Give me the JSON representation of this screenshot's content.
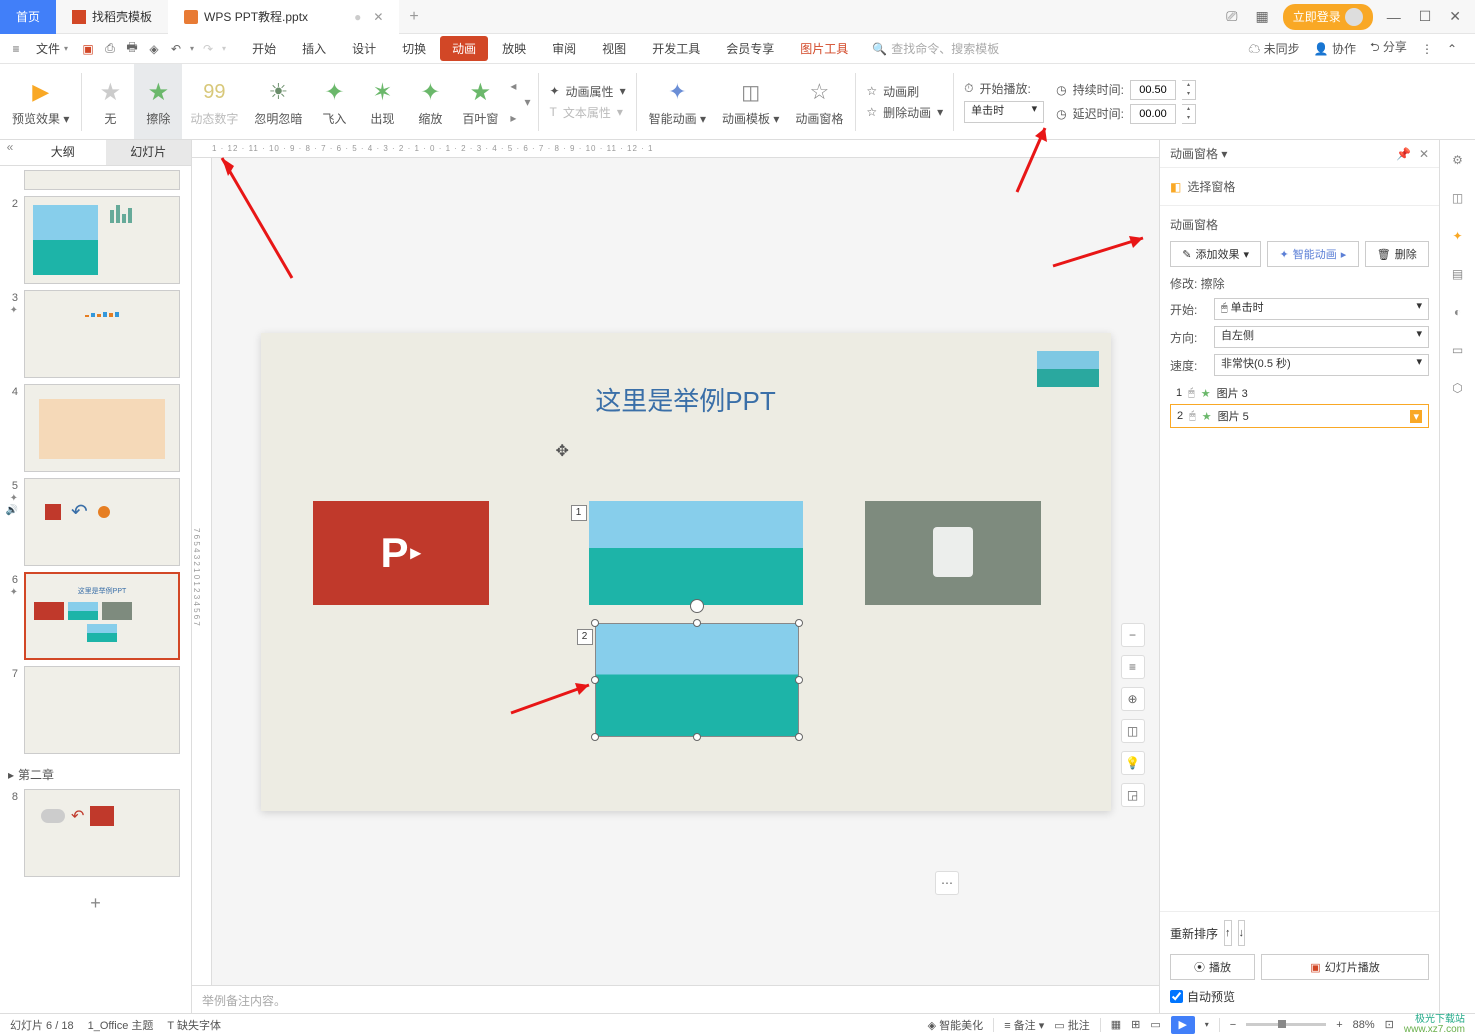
{
  "titleBar": {
    "homeTab": "首页",
    "templateTab": "找稻壳模板",
    "activeTab": "WPS PPT教程.pptx",
    "login": "立即登录"
  },
  "menuBar": {
    "file": "文件",
    "tabs": {
      "start": "开始",
      "insert": "插入",
      "design": "设计",
      "transition": "切换",
      "animation": "动画",
      "slideshow": "放映",
      "review": "审阅",
      "view": "视图",
      "dev": "开发工具",
      "member": "会员专享",
      "picTool": "图片工具"
    },
    "searchPlaceholder": "查找命令、搜索模板",
    "unsync": "未同步",
    "collab": "协作",
    "share": "分享"
  },
  "ribbon": {
    "preview": "预览效果",
    "anims": {
      "none": "无",
      "wipe": "擦除",
      "dynNum": "动态数字",
      "flash": "忽明忽暗",
      "flyIn": "飞入",
      "appear": "出现",
      "zoom": "缩放",
      "blinds": "百叶窗"
    },
    "animProps": "动画属性",
    "textProps": "文本属性",
    "smartAnim": "智能动画",
    "animTemplate": "动画模板",
    "animPane": "动画窗格",
    "animBrush": "动画刷",
    "delAnim": "删除动画",
    "startPlay": "开始播放:",
    "startPlayVal": "单击时",
    "duration": "持续时间:",
    "durationVal": "00.50",
    "delay": "延迟时间:",
    "delayVal": "00.00"
  },
  "thumbPanel": {
    "outline": "大纲",
    "slides": "幻灯片",
    "chapter2": "第二章",
    "nums": [
      "2",
      "3",
      "4",
      "5",
      "6",
      "7",
      "8"
    ]
  },
  "slide": {
    "title": "这里是举例PPT",
    "pptLogo": "P",
    "animTag1": "1",
    "animTag2": "2",
    "notesPlaceholder": "举例备注内容。"
  },
  "rightPanel": {
    "paneTitle": "动画窗格",
    "selectPane": "选择窗格",
    "sectionTitle": "动画窗格",
    "addEffect": "添加效果",
    "smartAnim": "智能动画",
    "delete": "删除",
    "modify": "修改: 擦除",
    "start": "开始:",
    "startVal": "单击时",
    "direction": "方向:",
    "directionVal": "自左侧",
    "speed": "速度:",
    "speedVal": "非常快(0.5 秒)",
    "item1": {
      "num": "1",
      "name": "图片 3"
    },
    "item2": {
      "num": "2",
      "name": "图片 5"
    },
    "reorder": "重新排序",
    "play": "播放",
    "slideshowPlay": "幻灯片播放",
    "autoPreview": "自动预览"
  },
  "statusBar": {
    "slideCount": "幻灯片 6 / 18",
    "theme": "1_Office 主题",
    "missingFont": "缺失字体",
    "smartBeauty": "智能美化",
    "notes": "备注",
    "comments": "批注",
    "zoom": "88%",
    "watermark1": "极光下载站",
    "watermark2": "www.xz7.com"
  }
}
